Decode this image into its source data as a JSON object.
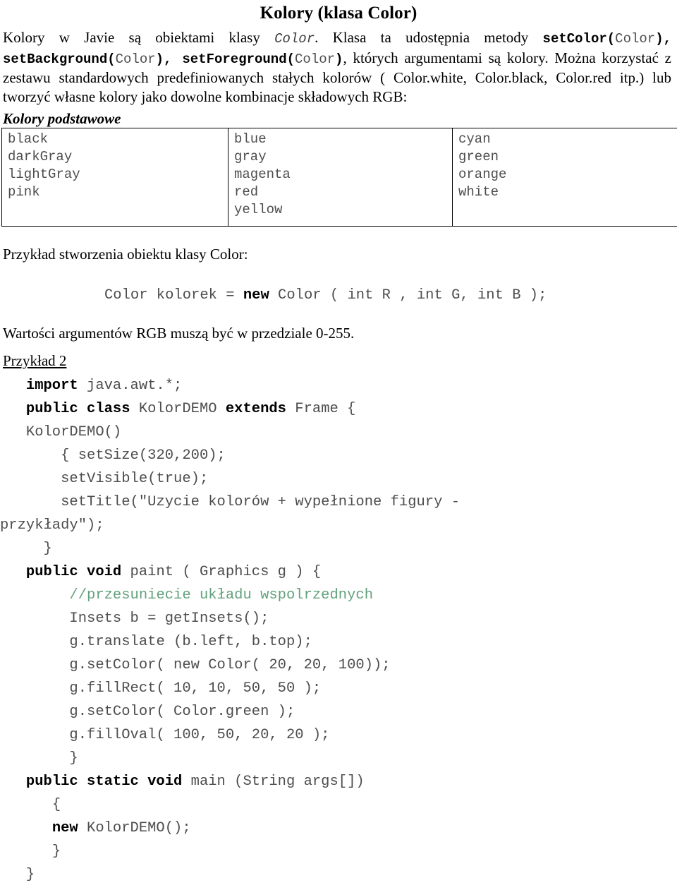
{
  "document": {
    "title": "Kolory (klasa Color)",
    "intro": {
      "seg1": "Kolory w Javie są obiektami klasy ",
      "code1": "Color",
      "seg2": ". Klasa ta udostępnia metody ",
      "code2_bold": "setColor",
      "code2_paren_open": "(",
      "code2_arg": "Color",
      "code2_paren_close": ")",
      "code2_comma": ", ",
      "code3_bold": "setBackground",
      "code3_paren_open": "(",
      "code3_arg": "Color",
      "code3_paren_close": ")",
      "code3_comma": ", ",
      "code4_bold": "setForeground",
      "code4_paren_open": "(",
      "code4_arg": "Color",
      "code4_paren_close": ")",
      "seg3": ", których argumentami są kolory. Można korzystać z zestawu standardowych predefiniowanych stałych kolorów ( Color.white, Color.black, Color.red itp.) lub tworzyć własne kolory jako dowolne kombinacje składowych RGB:"
    },
    "colors_heading": "Kolory podstawowe",
    "colors_table": {
      "columns": [
        [
          "black",
          "darkGray",
          "lightGray",
          "pink"
        ],
        [
          "blue",
          "gray",
          "magenta",
          "red",
          "yellow"
        ],
        [
          "cyan",
          "green",
          "orange",
          "white"
        ]
      ]
    },
    "example_intro": "Przykład stworzenia obiektu klasy Color:",
    "sample_code": {
      "pre": "Color kolorek = ",
      "kw": "new",
      "post": " Color ( int R , int G, int B );"
    },
    "rgb_note": "Wartości argumentów RGB muszą być w przedziale 0-255.",
    "example2_heading": "Przykład 2",
    "code_lines": [
      {
        "indent": 3,
        "parts": [
          {
            "t": "import",
            "k": true
          },
          {
            "t": " java.awt.*;",
            "k": false
          }
        ]
      },
      {
        "indent": 3,
        "parts": [
          {
            "t": "public class",
            "k": true
          },
          {
            "t": " KolorDEMO ",
            "k": false
          },
          {
            "t": "extends",
            "k": true
          },
          {
            "t": " Frame {",
            "k": false
          }
        ]
      },
      {
        "indent": 3,
        "parts": [
          {
            "t": "KolorDEMO()",
            "k": false
          }
        ]
      },
      {
        "indent": 7,
        "parts": [
          {
            "t": "{ setSize(320,200);",
            "k": false
          }
        ]
      },
      {
        "indent": 7,
        "parts": [
          {
            "t": "setVisible(true);",
            "k": false
          }
        ]
      },
      {
        "indent": 7,
        "parts": [
          {
            "t": "setTitle(\"Uzycie kolorów + wypełnione figury -",
            "k": false
          }
        ]
      },
      {
        "indent": 0,
        "parts": [
          {
            "t": "przykłady\");",
            "k": false
          }
        ]
      },
      {
        "indent": 5,
        "parts": [
          {
            "t": "}",
            "k": false
          }
        ]
      },
      {
        "indent": 3,
        "parts": [
          {
            "t": "public void",
            "k": true
          },
          {
            "t": " paint ( Graphics g ) {",
            "k": false
          }
        ]
      },
      {
        "indent": 8,
        "parts": [
          {
            "t": "//przesuniecie układu wspolrzednych",
            "k": false,
            "c": true
          }
        ]
      },
      {
        "indent": 8,
        "parts": [
          {
            "t": "Insets b = getInsets();",
            "k": false
          }
        ]
      },
      {
        "indent": 8,
        "parts": [
          {
            "t": "g.translate (b.left, b.top);",
            "k": false
          }
        ]
      },
      {
        "indent": 8,
        "parts": [
          {
            "t": "g.setColor( new Color( 20, 20, 100));",
            "k": false
          }
        ]
      },
      {
        "indent": 8,
        "parts": [
          {
            "t": "g.fillRect( 10, 10, 50, 50 );",
            "k": false
          }
        ]
      },
      {
        "indent": 8,
        "parts": [
          {
            "t": "g.setColor( Color.green );",
            "k": false
          }
        ]
      },
      {
        "indent": 8,
        "parts": [
          {
            "t": "g.fillOval( 100, 50, 20, 20 );",
            "k": false
          }
        ]
      },
      {
        "indent": 8,
        "parts": [
          {
            "t": "}",
            "k": false
          }
        ]
      },
      {
        "indent": 3,
        "parts": [
          {
            "t": "public static void",
            "k": true
          },
          {
            "t": " main (String args[])",
            "k": false
          }
        ]
      },
      {
        "indent": 6,
        "parts": [
          {
            "t": "{",
            "k": false
          }
        ]
      },
      {
        "indent": 6,
        "parts": [
          {
            "t": "new",
            "k": true
          },
          {
            "t": " KolorDEMO();",
            "k": false
          }
        ]
      },
      {
        "indent": 6,
        "parts": [
          {
            "t": "}",
            "k": false
          }
        ]
      },
      {
        "indent": 3,
        "parts": [
          {
            "t": "}",
            "k": false
          }
        ]
      }
    ],
    "colors": {
      "comment_green": "#63a27c",
      "code_grey": "#4d4d4d",
      "text_black": "#000000"
    }
  }
}
